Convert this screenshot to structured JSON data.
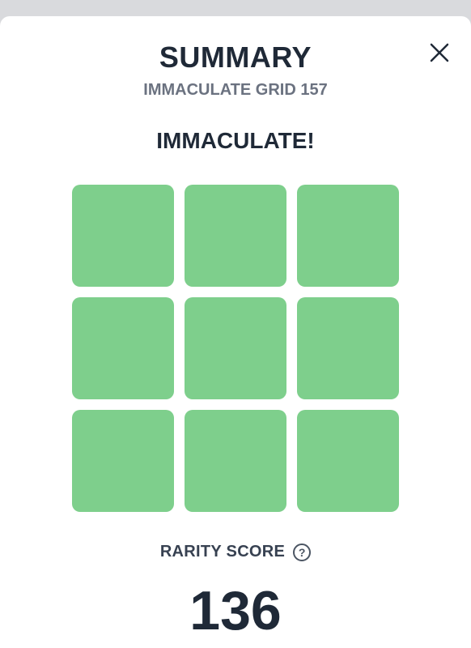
{
  "summary": {
    "title": "SUMMARY",
    "subtitle": "IMMACULATE GRID 157",
    "result": "IMMACULATE!"
  },
  "grid": {
    "cells": [
      {
        "status": "correct"
      },
      {
        "status": "correct"
      },
      {
        "status": "correct"
      },
      {
        "status": "correct"
      },
      {
        "status": "correct"
      },
      {
        "status": "correct"
      },
      {
        "status": "correct"
      },
      {
        "status": "correct"
      },
      {
        "status": "correct"
      }
    ],
    "correct_color": "#7ecf8c"
  },
  "rarity": {
    "label": "RARITY SCORE",
    "help_icon": "question-circle-icon",
    "help_glyph": "?",
    "score": "136"
  },
  "close_icon": "close-icon"
}
